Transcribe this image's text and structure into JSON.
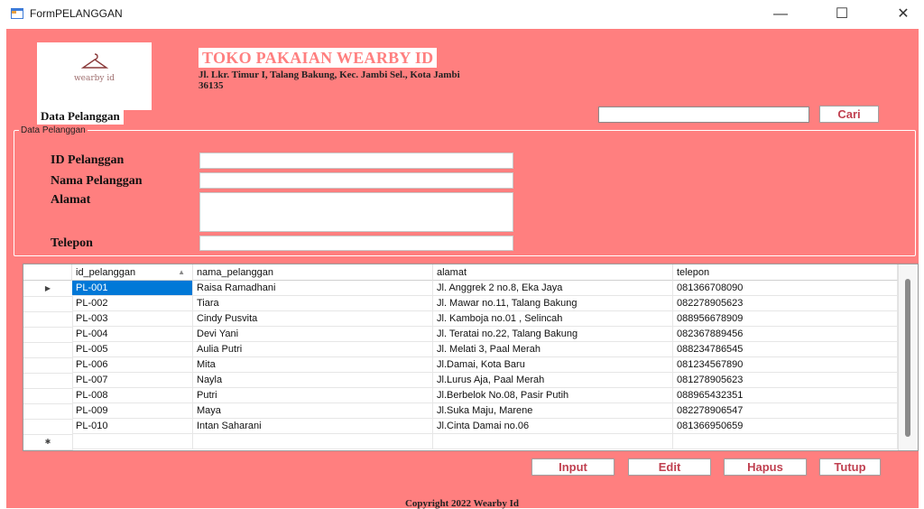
{
  "window": {
    "title": "FormPELANGGAN",
    "minimize": "—",
    "maximize": "☐",
    "close": "✕"
  },
  "header": {
    "logo_text": "wearby id",
    "store_name": "TOKO PAKAIAN WEARBY ID",
    "address_line1": "Jl. Lkr. Timur I, Talang Bakung, Kec. Jambi Sel., Kota Jambi",
    "address_line2": "36135",
    "page_label": "Data Pelanggan"
  },
  "search": {
    "value": "",
    "button": "Cari"
  },
  "form": {
    "legend": "Data Pelanggan",
    "labels": {
      "id": "ID Pelanggan",
      "nama": "Nama Pelanggan",
      "alamat": "Alamat",
      "telepon": "Telepon"
    },
    "values": {
      "id": "",
      "nama": "",
      "alamat": "",
      "telepon": ""
    }
  },
  "grid": {
    "columns": [
      "id_pelanggan",
      "nama_pelanggan",
      "alamat",
      "telepon"
    ],
    "sort_indicator": "▲",
    "rows": [
      [
        "PL-001",
        "Raisa Ramadhani",
        "Jl. Anggrek 2 no.8, Eka Jaya",
        "081366708090"
      ],
      [
        "PL-002",
        "Tiara",
        "Jl. Mawar no.11, Talang Bakung",
        "082278905623"
      ],
      [
        "PL-003",
        "Cindy Pusvita",
        "Jl. Kamboja no.01 , Selincah",
        "088956678909"
      ],
      [
        "PL-004",
        "Devi Yani",
        "Jl. Teratai no.22, Talang Bakung",
        "082367889456"
      ],
      [
        "PL-005",
        "Aulia Putri",
        "Jl. Melati 3, Paal Merah",
        "088234786545"
      ],
      [
        "PL-006",
        "Mita",
        "Jl.Damai, Kota Baru",
        "081234567890"
      ],
      [
        "PL-007",
        "Nayla",
        "Jl.Lurus Aja, Paal Merah",
        "081278905623"
      ],
      [
        "PL-008",
        "Putri",
        "Jl.Berbelok No.08, Pasir Putih",
        "088965432351"
      ],
      [
        "PL-009",
        "Maya",
        "Jl.Suka Maju, Marene",
        "082278906547"
      ],
      [
        "PL-010",
        "Intan Saharani",
        "Jl.Cinta Damai no.06",
        "081366950659"
      ]
    ],
    "selected_row_marker": "▶",
    "new_row_marker": "✱"
  },
  "buttons": {
    "input": "Input",
    "edit": "Edit",
    "hapus": "Hapus",
    "tutup": "Tutup"
  },
  "footer": {
    "copyright": "Copyright 2022 Wearby Id"
  },
  "colors": {
    "form_background": "#ff7f7f",
    "selection": "#0078d7",
    "button_text": "#c04050"
  }
}
